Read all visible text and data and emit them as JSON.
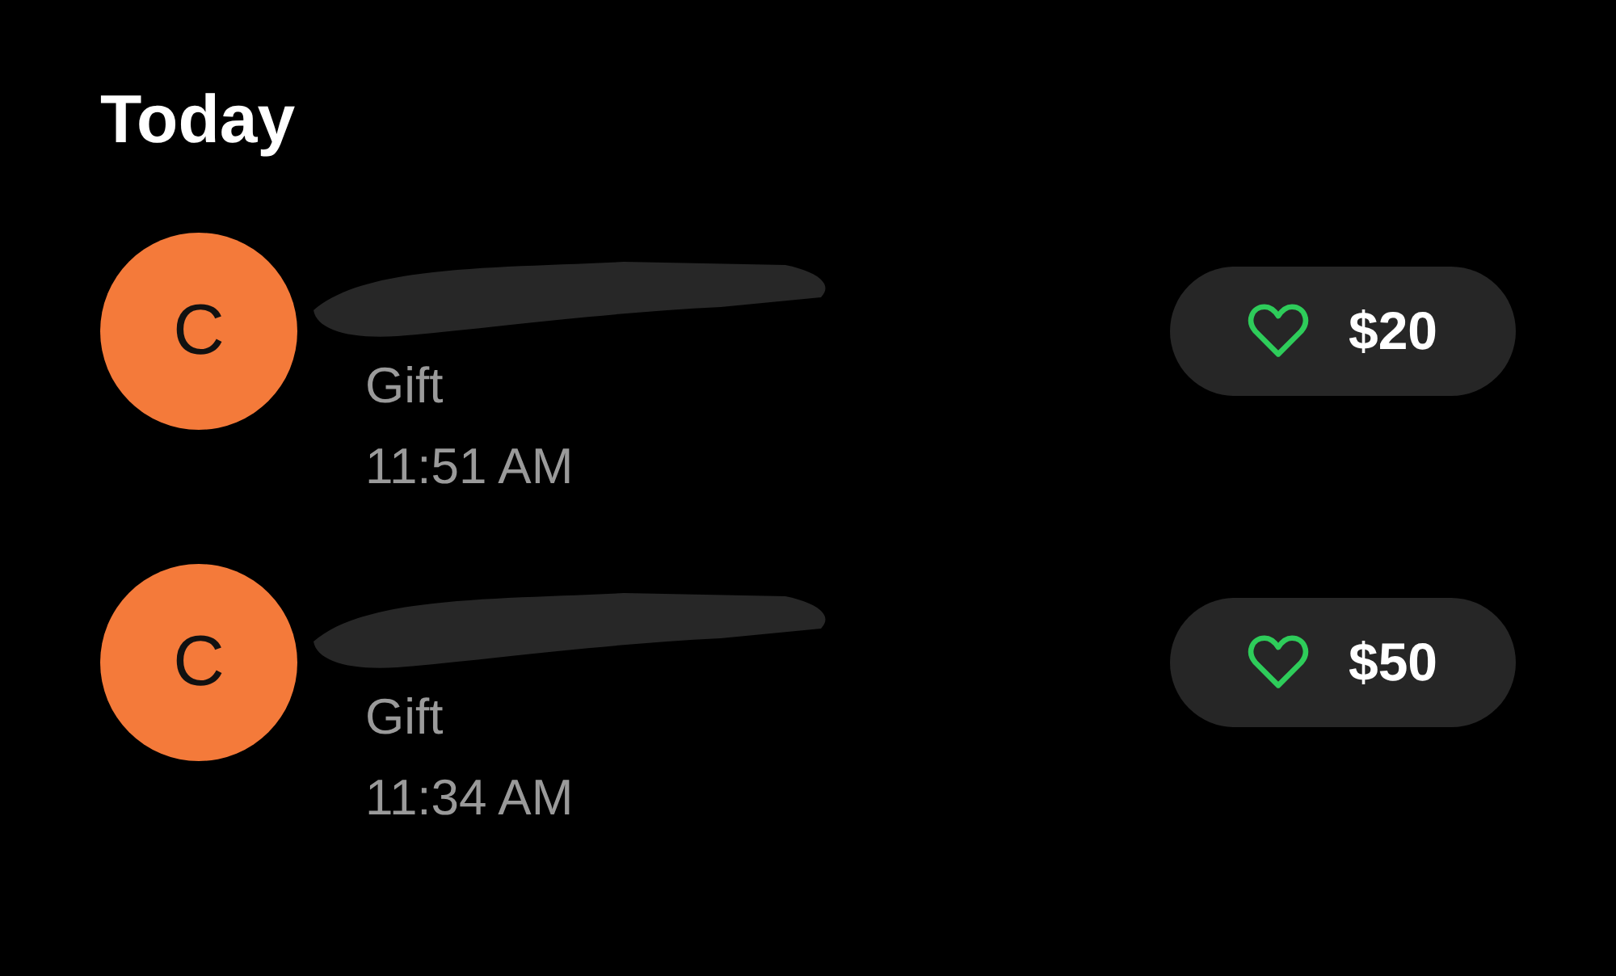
{
  "section_title": "Today",
  "transactions": [
    {
      "avatar_letter": "C",
      "note": "Gift",
      "time": "11:51 AM",
      "amount": "$20"
    },
    {
      "avatar_letter": "C",
      "note": "Gift",
      "time": "11:34 AM",
      "amount": "$50"
    }
  ]
}
